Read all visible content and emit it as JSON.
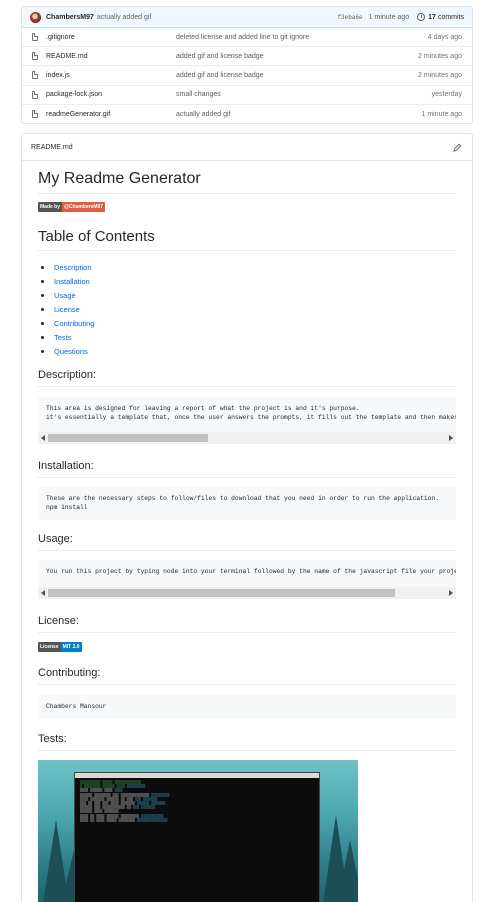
{
  "latest_commit": {
    "author": "ChambersM97",
    "message": "actually added gif",
    "sha": "f3eba6e",
    "time": "1 minute ago",
    "commit_count": "17",
    "commits_label": "commits"
  },
  "files": [
    {
      "name": ".gitignore",
      "commit": "deleted license and added line to git ignore",
      "age": "4 days ago"
    },
    {
      "name": "README.md",
      "commit": "added gif and license badge",
      "age": "2 minutes ago"
    },
    {
      "name": "index.js",
      "commit": "added gif and license badge",
      "age": "2 minutes ago"
    },
    {
      "name": "package-lock.json",
      "commit": "small changes",
      "age": "yesterday"
    },
    {
      "name": "readmeGenerator.gif",
      "commit": "actually added gif",
      "age": "1 minute ago"
    }
  ],
  "readme": {
    "filename": "README.md",
    "title": "My Readme Generator",
    "made_by_badge": {
      "left": "Made by",
      "right": "@ChambersM97",
      "color": "#e05d44"
    },
    "toc_heading": "Table of Contents",
    "toc": [
      "Description",
      "Installation",
      "Usage",
      "License",
      "Contributing",
      "Tests",
      "Questions"
    ],
    "description_heading": "Description:",
    "description_code": "This area is designed for leaving a report of what the project is and it's purpose.\nit's essentially a template that, once the user answers the prompts, it fills out the template and then makes",
    "installation_heading": "Installation:",
    "installation_code": "These are the necessary steps to follow/files to download that you need in order to run the application.\nnpm install",
    "usage_heading": "Usage:",
    "usage_code": "You run this project by typing node into your terminal followed by the name of the javascript file your project",
    "license_heading": "License:",
    "license_badge": {
      "left": "License",
      "right": "MIT 2.0",
      "color": "#007ec6"
    },
    "contributing_heading": "Contributing:",
    "contributing_code": "Chambers Mansour",
    "tests_heading": "Tests:"
  },
  "icons": {
    "file": "file-icon",
    "history": "clock-icon",
    "edit": "pencil-icon"
  }
}
